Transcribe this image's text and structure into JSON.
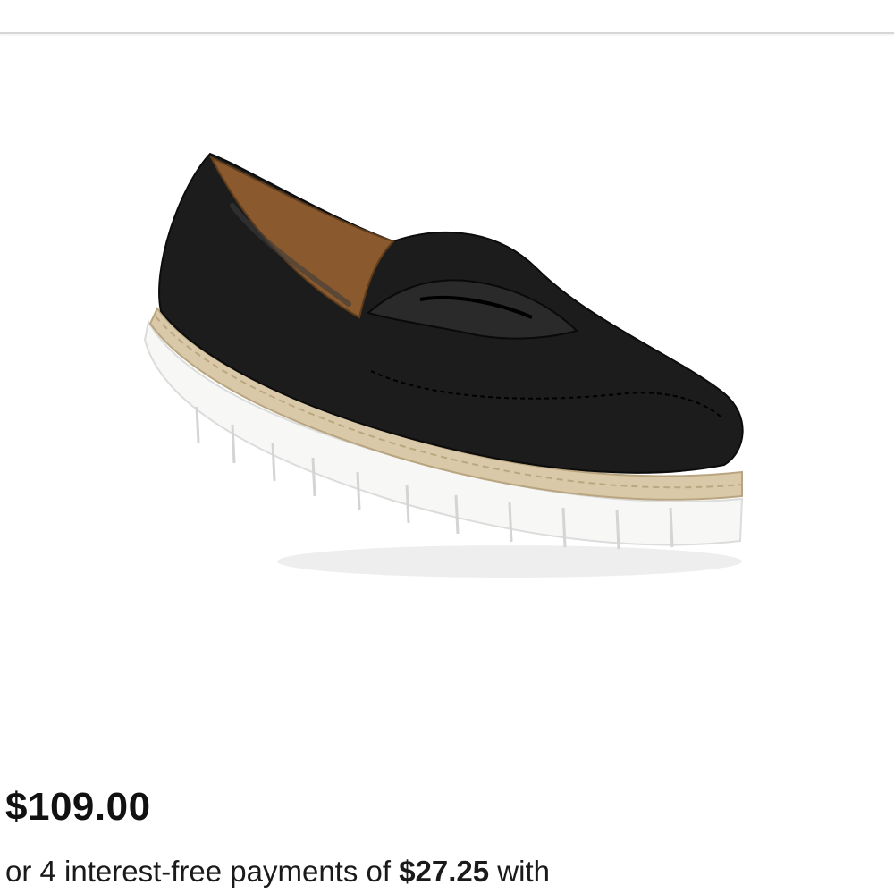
{
  "product": {
    "image_icon": "black-loafer-platform-shoe",
    "price": "$109.00",
    "installments": {
      "prefix": "or 4 interest-free payments of ",
      "amount": "$27.25",
      "suffix": " with"
    }
  }
}
